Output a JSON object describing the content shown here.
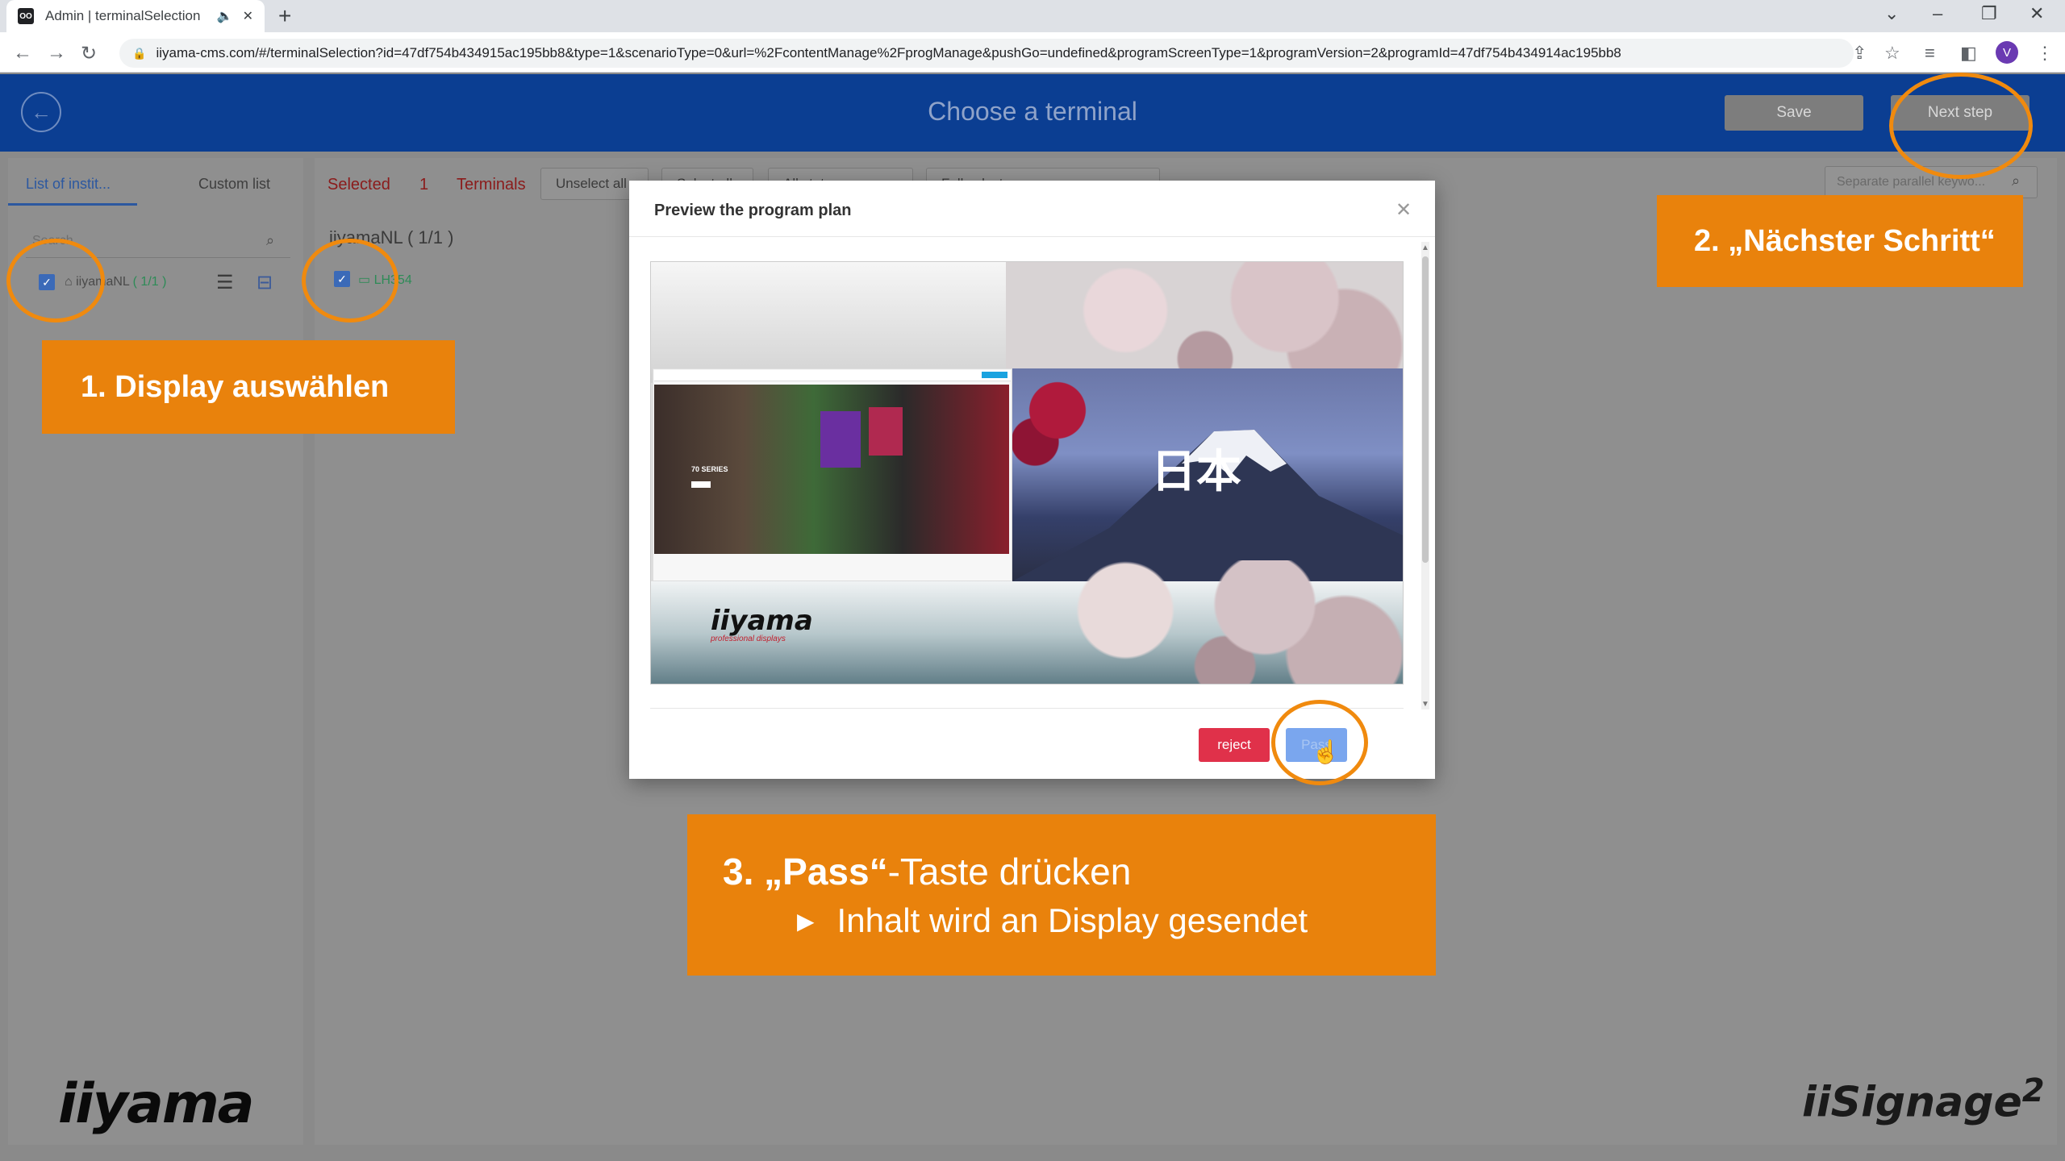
{
  "browser": {
    "tab_title": "Admin | terminalSelection",
    "favicon_text": "OO",
    "url": "iiyama-cms.com/#/terminalSelection?id=47df754b434915ac195bb8&type=1&scenarioType=0&url=%2FcontentManage%2FprogManage&pushGo=undefined&programScreenType=1&programVersion=2&programId=47df754b434914ac195bb8",
    "profile_initial": "V"
  },
  "header": {
    "title": "Choose a terminal",
    "save_label": "Save",
    "next_label": "Next step"
  },
  "left_panel": {
    "tab_institutions": "List of instit...",
    "tab_custom": "Custom list",
    "search_placeholder": "Search",
    "institution_name": "iiyamaNL",
    "institution_count": "( 1/1 )"
  },
  "main": {
    "selected_label": "Selected",
    "selected_count": "1",
    "terminals_label": "Terminals",
    "unselect_all": "Unselect all",
    "select_all": "Select all",
    "filter_1": "All status",
    "filter_2": "Full select",
    "keyword_placeholder": "Separate parallel keywo...",
    "group_heading": "iiyamaNL ( 1/1 )",
    "terminal_name": "LH354"
  },
  "modal": {
    "title": "Preview the program plan",
    "reject_label": "reject",
    "pass_label": "Pass",
    "preview": {
      "kanji": "日本",
      "store_text": "70 SERIES",
      "logo": "iiyama",
      "logo_sub": "professional displays"
    }
  },
  "annotations": {
    "step1": "1. Display auswählen",
    "step2": "2. „Nächster Schritt“",
    "step3_bold": "3. „Pass“",
    "step3_rest": "-Taste drücken",
    "step3_sub": "Inhalt wird an Display gesendet"
  },
  "branding": {
    "left_logo": "iiyama",
    "right_logo": "iiSignage",
    "right_logo_sup": "2"
  },
  "colors": {
    "header_blue": "#0b3e92",
    "callout_orange": "#e9820c",
    "reject_red": "#e0314a",
    "pass_blue": "#7aa6ee"
  }
}
